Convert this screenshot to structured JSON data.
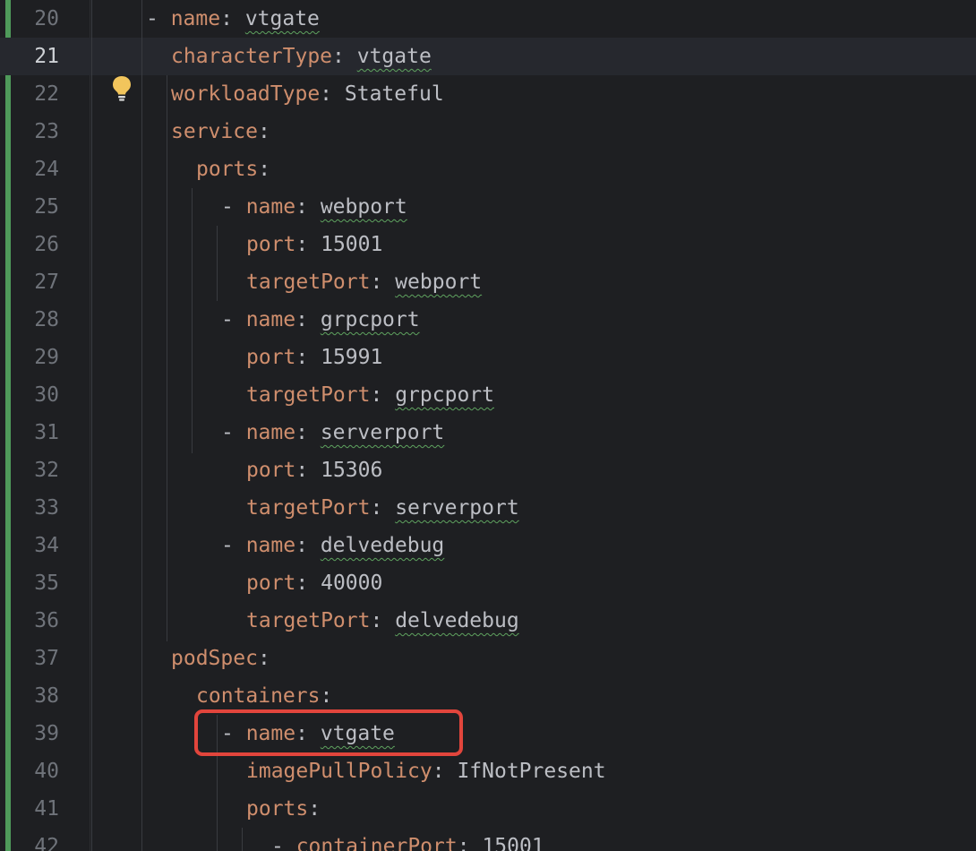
{
  "editor": {
    "current_line": "21",
    "lines": [
      {
        "num": "20",
        "dash": "- ",
        "key": "name",
        "value": "vtgate",
        "squiggle": true
      },
      {
        "num": "21",
        "dash": "",
        "key": "characterType",
        "value": "vtgate",
        "squiggle": true
      },
      {
        "num": "22",
        "dash": "",
        "key": "workloadType",
        "value": "Stateful",
        "squiggle": false
      },
      {
        "num": "23",
        "dash": "",
        "key": "service",
        "value": "",
        "squiggle": false
      },
      {
        "num": "24",
        "dash": "",
        "key": "ports",
        "value": "",
        "squiggle": false
      },
      {
        "num": "25",
        "dash": "- ",
        "key": "name",
        "value": "webport",
        "squiggle": true
      },
      {
        "num": "26",
        "dash": "",
        "key": "port",
        "value": "15001",
        "squiggle": false
      },
      {
        "num": "27",
        "dash": "",
        "key": "targetPort",
        "value": "webport",
        "squiggle": true
      },
      {
        "num": "28",
        "dash": "- ",
        "key": "name",
        "value": "grpcport",
        "squiggle": true
      },
      {
        "num": "29",
        "dash": "",
        "key": "port",
        "value": "15991",
        "squiggle": false
      },
      {
        "num": "30",
        "dash": "",
        "key": "targetPort",
        "value": "grpcport",
        "squiggle": true
      },
      {
        "num": "31",
        "dash": "- ",
        "key": "name",
        "value": "serverport",
        "squiggle": true
      },
      {
        "num": "32",
        "dash": "",
        "key": "port",
        "value": "15306",
        "squiggle": false
      },
      {
        "num": "33",
        "dash": "",
        "key": "targetPort",
        "value": "serverport",
        "squiggle": true
      },
      {
        "num": "34",
        "dash": "- ",
        "key": "name",
        "value": "delvedebug",
        "squiggle": true
      },
      {
        "num": "35",
        "dash": "",
        "key": "port",
        "value": "40000",
        "squiggle": false
      },
      {
        "num": "36",
        "dash": "",
        "key": "targetPort",
        "value": "delvedebug",
        "squiggle": true
      },
      {
        "num": "37",
        "dash": "",
        "key": "podSpec",
        "value": "",
        "squiggle": false
      },
      {
        "num": "38",
        "dash": "",
        "key": "containers",
        "value": "",
        "squiggle": false
      },
      {
        "num": "39",
        "dash": "- ",
        "key": "name",
        "value": "vtgate",
        "squiggle": true
      },
      {
        "num": "40",
        "dash": "",
        "key": "imagePullPolicy",
        "value": "IfNotPresent",
        "squiggle": false
      },
      {
        "num": "41",
        "dash": "",
        "key": "ports",
        "value": "",
        "squiggle": false
      },
      {
        "num": "42",
        "dash": "- ",
        "key": "containerPort",
        "value": "15001",
        "squiggle": false
      }
    ]
  },
  "icons": {
    "intention": "lightbulb-icon"
  },
  "colors": {
    "background": "#1e1f22",
    "current_line": "#26282e",
    "key": "#cf8e6d",
    "text": "#bcbec4",
    "vcs_added": "#4f9a5a",
    "highlight_box": "#e2453c"
  }
}
